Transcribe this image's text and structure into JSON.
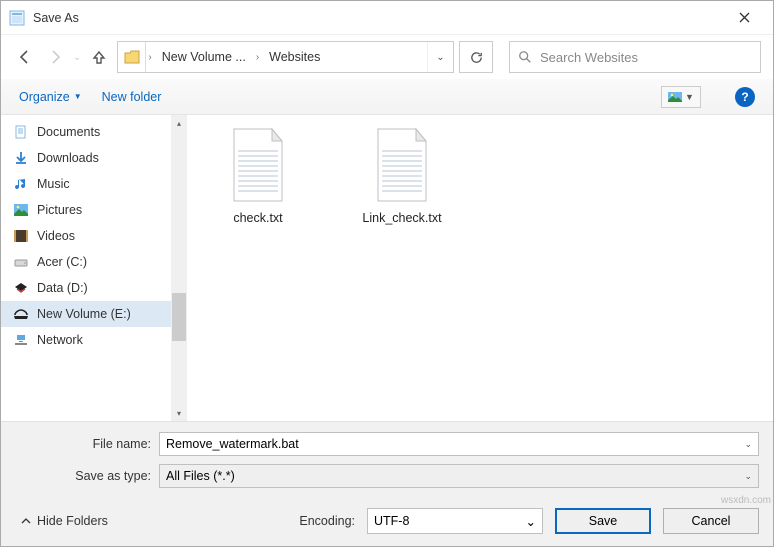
{
  "title": "Save As",
  "breadcrumb": {
    "seg1": "New Volume ...",
    "seg2": "Websites"
  },
  "search": {
    "placeholder": "Search Websites"
  },
  "toolbar": {
    "organize": "Organize",
    "newfolder": "New folder"
  },
  "sidebar": {
    "items": [
      {
        "label": "Documents",
        "icon": "documents",
        "selected": false
      },
      {
        "label": "Downloads",
        "icon": "downloads",
        "selected": false
      },
      {
        "label": "Music",
        "icon": "music",
        "selected": false
      },
      {
        "label": "Pictures",
        "icon": "pictures",
        "selected": false
      },
      {
        "label": "Videos",
        "icon": "videos",
        "selected": false
      },
      {
        "label": "Acer (C:)",
        "icon": "drive",
        "selected": false
      },
      {
        "label": "Data (D:)",
        "icon": "data",
        "selected": false
      },
      {
        "label": "New Volume (E:)",
        "icon": "volume",
        "selected": true
      },
      {
        "label": "Network",
        "icon": "network",
        "selected": false
      }
    ]
  },
  "files": [
    {
      "name": "check.txt"
    },
    {
      "name": "Link_check.txt"
    }
  ],
  "filename_label": "File name:",
  "filename_value": "Remove_watermark.bat",
  "type_label": "Save as type:",
  "type_value": "All Files  (*.*)",
  "hide_folders": "Hide Folders",
  "encoding_label": "Encoding:",
  "encoding_value": "UTF-8",
  "save": "Save",
  "cancel": "Cancel",
  "watermark": "wsxdn.com"
}
